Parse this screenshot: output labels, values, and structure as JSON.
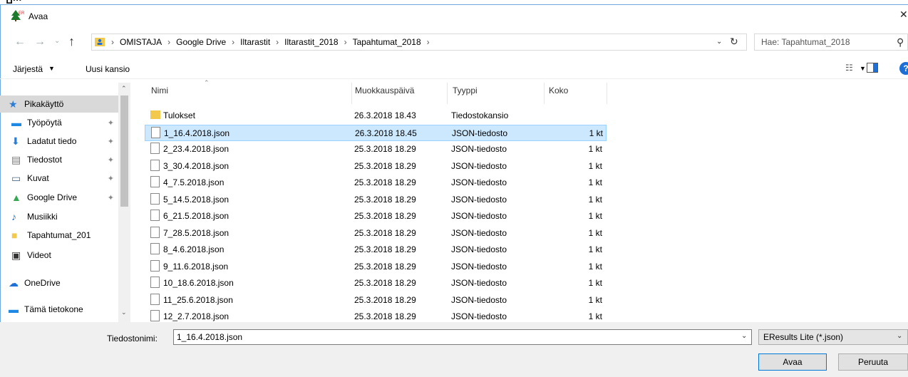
{
  "window": {
    "top_fragment": "ייים",
    "title": "Avaa",
    "close_glyph": "✕"
  },
  "nav_buttons": {
    "back": "←",
    "forward": "→",
    "history": "⌄",
    "up": "↑"
  },
  "address": {
    "crumbs": [
      "OMISTAJA",
      "Google Drive",
      "Iltarastit",
      "Iltarastit_2018",
      "Tapahtumat_2018"
    ],
    "separator": "›"
  },
  "search": {
    "placeholder": "Hae: Tapahtumat_2018"
  },
  "toolbar": {
    "organize_label": "Järjestä",
    "new_folder_label": "Uusi kansio",
    "help_label": "?"
  },
  "navigation": [
    {
      "label": "Pikakäyttö",
      "icon": "star-icon",
      "pinned": false,
      "selected": true,
      "color": "#2b7cd3"
    },
    {
      "label": "Työpöytä",
      "icon": "desktop-icon",
      "pinned": true,
      "selected": false,
      "color": "#1e88e5"
    },
    {
      "label": "Ladatut tiedo",
      "icon": "download-icon",
      "pinned": true,
      "selected": false,
      "color": "#2b7cd3"
    },
    {
      "label": "Tiedostot",
      "icon": "documents-icon",
      "pinned": true,
      "selected": false,
      "color": "#777"
    },
    {
      "label": "Kuvat",
      "icon": "pictures-icon",
      "pinned": true,
      "selected": false,
      "color": "#4a6a8a"
    },
    {
      "label": "Google Drive",
      "icon": "google-drive-icon",
      "pinned": true,
      "selected": false,
      "color": "#34a853"
    },
    {
      "label": "Musiikki",
      "icon": "music-icon",
      "pinned": false,
      "selected": false,
      "color": "#1e6fd6"
    },
    {
      "label": "Tapahtumat_201",
      "icon": "folder-user-icon",
      "pinned": false,
      "selected": false,
      "color": "#f2c94c"
    },
    {
      "label": "Videot",
      "icon": "videos-icon",
      "pinned": false,
      "selected": false,
      "color": "#333"
    },
    {
      "label": "OneDrive",
      "icon": "onedrive-icon",
      "pinned": false,
      "selected": false,
      "color": "#1e6fd6"
    },
    {
      "label": "Tämä tietokone",
      "icon": "computer-icon",
      "pinned": false,
      "selected": false,
      "color": "#1e88e5"
    }
  ],
  "columns": {
    "name": "Nimi",
    "modified": "Muokkauspäivä",
    "type": "Tyyppi",
    "size": "Koko"
  },
  "files": [
    {
      "name": "Tulokset",
      "modified": "26.3.2018 18.43",
      "type": "Tiedostokansio",
      "size": "",
      "folder": true,
      "selected": false
    },
    {
      "name": "1_16.4.2018.json",
      "modified": "26.3.2018 18.45",
      "type": "JSON-tiedosto",
      "size": "1 kt",
      "folder": false,
      "selected": true
    },
    {
      "name": "2_23.4.2018.json",
      "modified": "25.3.2018 18.29",
      "type": "JSON-tiedosto",
      "size": "1 kt",
      "folder": false,
      "selected": false
    },
    {
      "name": "3_30.4.2018.json",
      "modified": "25.3.2018 18.29",
      "type": "JSON-tiedosto",
      "size": "1 kt",
      "folder": false,
      "selected": false
    },
    {
      "name": "4_7.5.2018.json",
      "modified": "25.3.2018 18.29",
      "type": "JSON-tiedosto",
      "size": "1 kt",
      "folder": false,
      "selected": false
    },
    {
      "name": "5_14.5.2018.json",
      "modified": "25.3.2018 18.29",
      "type": "JSON-tiedosto",
      "size": "1 kt",
      "folder": false,
      "selected": false
    },
    {
      "name": "6_21.5.2018.json",
      "modified": "25.3.2018 18.29",
      "type": "JSON-tiedosto",
      "size": "1 kt",
      "folder": false,
      "selected": false
    },
    {
      "name": "7_28.5.2018.json",
      "modified": "25.3.2018 18.29",
      "type": "JSON-tiedosto",
      "size": "1 kt",
      "folder": false,
      "selected": false
    },
    {
      "name": "8_4.6.2018.json",
      "modified": "25.3.2018 18.29",
      "type": "JSON-tiedosto",
      "size": "1 kt",
      "folder": false,
      "selected": false
    },
    {
      "name": "9_11.6.2018.json",
      "modified": "25.3.2018 18.29",
      "type": "JSON-tiedosto",
      "size": "1 kt",
      "folder": false,
      "selected": false
    },
    {
      "name": "10_18.6.2018.json",
      "modified": "25.3.2018 18.29",
      "type": "JSON-tiedosto",
      "size": "1 kt",
      "folder": false,
      "selected": false
    },
    {
      "name": "11_25.6.2018.json",
      "modified": "25.3.2018 18.29",
      "type": "JSON-tiedosto",
      "size": "1 kt",
      "folder": false,
      "selected": false
    },
    {
      "name": "12_2.7.2018.json",
      "modified": "25.3.2018 18.29",
      "type": "JSON-tiedosto",
      "size": "1 kt",
      "folder": false,
      "selected": false
    }
  ],
  "bottom": {
    "filename_label": "Tiedostonimi:",
    "filename_value": "1_16.4.2018.json",
    "filter_value": "EResults Lite (*.json)",
    "open_label": "Avaa",
    "cancel_label": "Peruuta"
  }
}
